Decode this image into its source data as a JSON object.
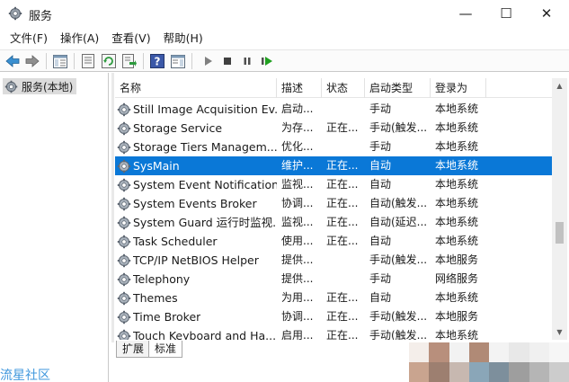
{
  "window": {
    "title": "服务",
    "minimize_glyph": "—",
    "maximize_glyph": "☐",
    "close_glyph": "✕"
  },
  "menu": {
    "items": [
      "文件(F)",
      "操作(A)",
      "查看(V)",
      "帮助(H)"
    ]
  },
  "toolbar": {
    "icons": [
      "back-arrow-icon",
      "forward-arrow-icon",
      "show-hide-tree-icon",
      "properties-icon",
      "refresh-icon",
      "export-list-icon",
      "help-icon",
      "show-hide-action-pane-icon",
      "start-service-icon",
      "stop-service-icon",
      "pause-service-icon",
      "restart-service-icon"
    ]
  },
  "tree": {
    "root_label": "服务(本地)"
  },
  "table": {
    "headers": {
      "name": "名称",
      "description": "描述",
      "status": "状态",
      "startup_type": "启动类型",
      "log_on_as": "登录为"
    },
    "rows": [
      {
        "name": "Still Image Acquisition Ev...",
        "description": "启动...",
        "status": "",
        "startup_type": "手动",
        "log_on_as": "本地系统"
      },
      {
        "name": "Storage Service",
        "description": "为存...",
        "status": "正在...",
        "startup_type": "手动(触发...",
        "log_on_as": "本地系统"
      },
      {
        "name": "Storage Tiers Managem...",
        "description": "优化...",
        "status": "",
        "startup_type": "手动",
        "log_on_as": "本地系统"
      },
      {
        "name": "SysMain",
        "description": "维护...",
        "status": "正在...",
        "startup_type": "自动",
        "log_on_as": "本地系统"
      },
      {
        "name": "System Event Notification...",
        "description": "监视...",
        "status": "正在...",
        "startup_type": "自动",
        "log_on_as": "本地系统"
      },
      {
        "name": "System Events Broker",
        "description": "协调...",
        "status": "正在...",
        "startup_type": "自动(触发...",
        "log_on_as": "本地系统"
      },
      {
        "name": "System Guard 运行时监视...",
        "description": "监视...",
        "status": "正在...",
        "startup_type": "自动(延迟...",
        "log_on_as": "本地系统"
      },
      {
        "name": "Task Scheduler",
        "description": "使用...",
        "status": "正在...",
        "startup_type": "自动",
        "log_on_as": "本地系统"
      },
      {
        "name": "TCP/IP NetBIOS Helper",
        "description": "提供...",
        "status": "",
        "startup_type": "手动(触发...",
        "log_on_as": "本地服务"
      },
      {
        "name": "Telephony",
        "description": "提供...",
        "status": "",
        "startup_type": "手动",
        "log_on_as": "网络服务"
      },
      {
        "name": "Themes",
        "description": "为用...",
        "status": "正在...",
        "startup_type": "自动",
        "log_on_as": "本地系统"
      },
      {
        "name": "Time Broker",
        "description": "协调...",
        "status": "正在...",
        "startup_type": "手动(触发...",
        "log_on_as": "本地服务"
      },
      {
        "name": "Touch Keyboard and Ha...",
        "description": "启用...",
        "status": "正在...",
        "startup_type": "手动(触发...",
        "log_on_as": "本地系统"
      }
    ],
    "selected_index": 3
  },
  "tabs": {
    "extended": "扩展",
    "standard": "标准",
    "active": "standard"
  },
  "watermark": {
    "text": "流星社区"
  },
  "colors": {
    "selection": "#0a78d7",
    "selection_text": "#ffffff",
    "nav_arrow": "#2e8b57",
    "play_green": "#20a020",
    "stop_dark": "#404040",
    "watermark_blue": "#1e86d8"
  }
}
